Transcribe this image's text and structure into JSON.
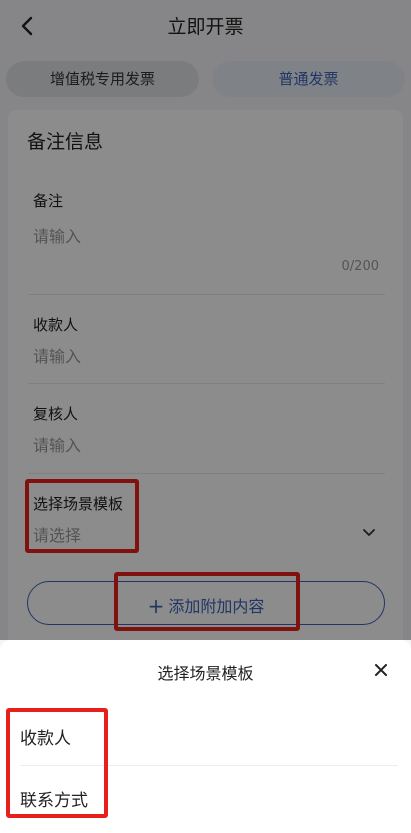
{
  "header": {
    "title": "立即开票"
  },
  "tabs": [
    {
      "label": "增值税专用发票",
      "selected": false
    },
    {
      "label": "普通发票",
      "selected": true
    }
  ],
  "card": {
    "title": "备注信息",
    "remark": {
      "label": "备注",
      "placeholder": "请输入",
      "counter": "0/200"
    },
    "payee": {
      "label": "收款人",
      "placeholder": "请输入"
    },
    "reviewer": {
      "label": "复核人",
      "placeholder": "请输入"
    },
    "scene_template": {
      "label": "选择场景模板",
      "placeholder": "请选择"
    },
    "add_button": {
      "plus": "+",
      "label": "添加附加内容"
    }
  },
  "sheet": {
    "title": "选择场景模板",
    "options": [
      "收款人",
      "联系方式"
    ]
  },
  "colors": {
    "accent": "#3f62b6",
    "highlight": "#e8201c",
    "overlay": "rgba(0,0,0,0.45)"
  }
}
